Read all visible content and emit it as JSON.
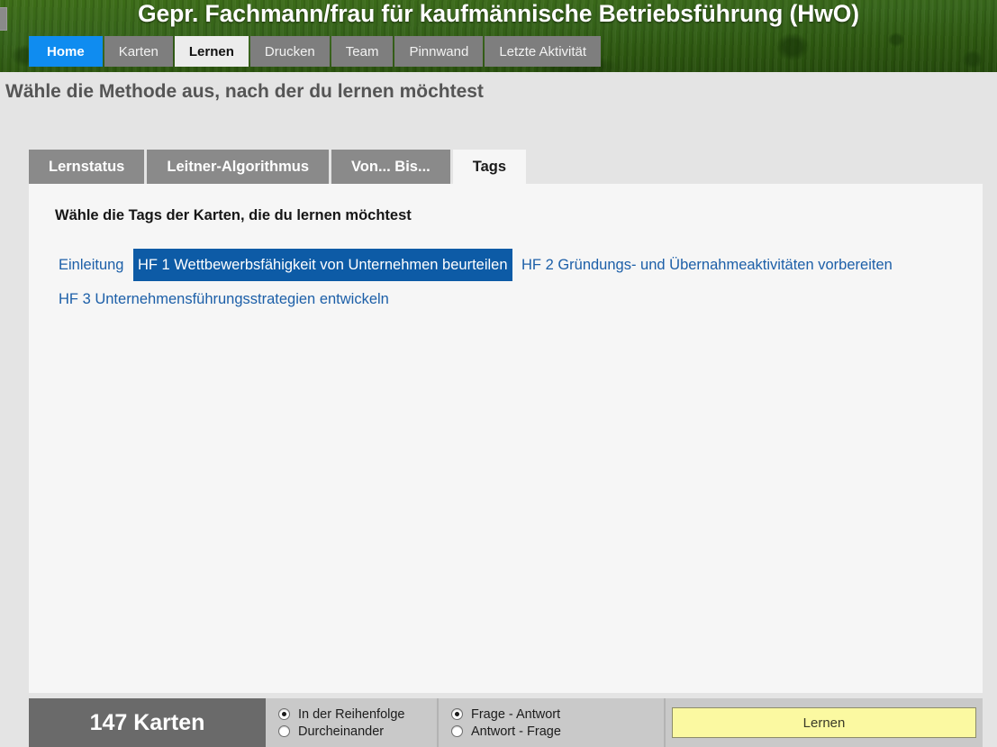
{
  "header": {
    "title": "Gepr. Fachmann/frau für kaufmännische Betriebsführung (HwO)",
    "background_color": "#2e5c12",
    "nav": [
      {
        "label": "Home",
        "state": "home"
      },
      {
        "label": "Karten",
        "state": "normal"
      },
      {
        "label": "Lernen",
        "state": "active"
      },
      {
        "label": "Drucken",
        "state": "normal"
      },
      {
        "label": "Team",
        "state": "normal"
      },
      {
        "label": "Pinnwand",
        "state": "normal"
      },
      {
        "label": "Letzte Aktivität",
        "state": "normal"
      }
    ]
  },
  "page": {
    "heading": "Wähle die Methode aus, nach der du lernen möchtest"
  },
  "method_tabs": [
    {
      "label": "Lernstatus",
      "active": false
    },
    {
      "label": "Leitner-Algorithmus",
      "active": false
    },
    {
      "label": "Von... Bis...",
      "active": false
    },
    {
      "label": "Tags",
      "active": true
    }
  ],
  "panel": {
    "title": "Wähle die Tags der Karten, die du lernen möchtest",
    "tags": [
      {
        "label": "Einleitung",
        "selected": false
      },
      {
        "label": "HF 1 Wettbewerbsfähigkeit von Unternehmen beurteilen",
        "selected": true
      },
      {
        "label": "HF 2 Gründungs- und Übernahmeaktivitäten vorbereiten",
        "selected": false
      },
      {
        "label": "HF 3 Unternehmensführungsstrategien entwickeln",
        "selected": false
      }
    ],
    "tag_link_color": "#1c5fa8",
    "tag_selected_bg": "#0d5ba6"
  },
  "bottom_bar": {
    "card_count": "147 Karten",
    "order_options": [
      {
        "label": "In der Reihenfolge",
        "checked": true
      },
      {
        "label": "Durcheinander",
        "checked": false
      }
    ],
    "direction_options": [
      {
        "label": "Frage - Antwort",
        "checked": true
      },
      {
        "label": "Antwort - Frage",
        "checked": false
      }
    ],
    "submit_label": "Lernen",
    "submit_color": "#fbf9a1"
  }
}
